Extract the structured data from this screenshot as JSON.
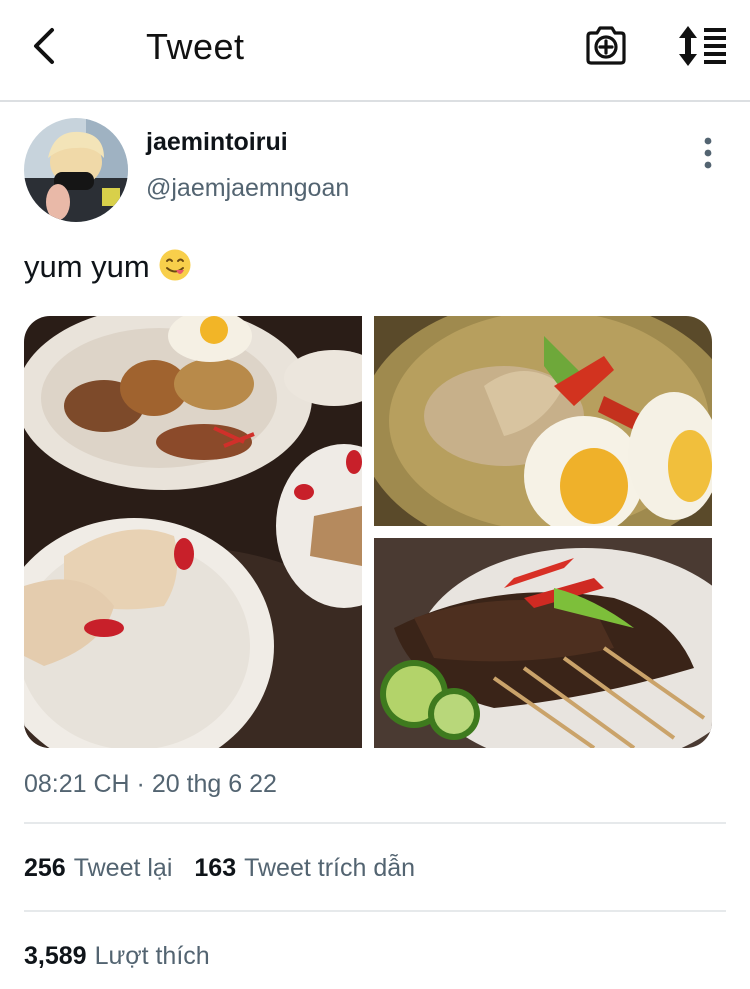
{
  "header": {
    "title": "Tweet"
  },
  "user": {
    "display_name": "jaemintoirui",
    "handle": "@jaemjaemngoan"
  },
  "tweet": {
    "text": "yum yum",
    "emoji": "yum-face-emoji",
    "timestamp": "08:21 CH · 20 thg 6 22"
  },
  "stats": {
    "retweets_count": "256",
    "retweets_label": "Tweet lại",
    "quotes_count": "163",
    "quotes_label": "Tweet trích dẫn",
    "likes_count": "3,589",
    "likes_label": "Lượt thích"
  },
  "icons": {
    "back": "chevron-left-icon",
    "camera": "camera-plus-icon",
    "sort": "sort-arrows-list-icon",
    "more": "vertical-ellipsis-icon"
  },
  "colors": {
    "text": "#0f1419",
    "secondary": "#536471",
    "divider": "#e6e9eb"
  }
}
